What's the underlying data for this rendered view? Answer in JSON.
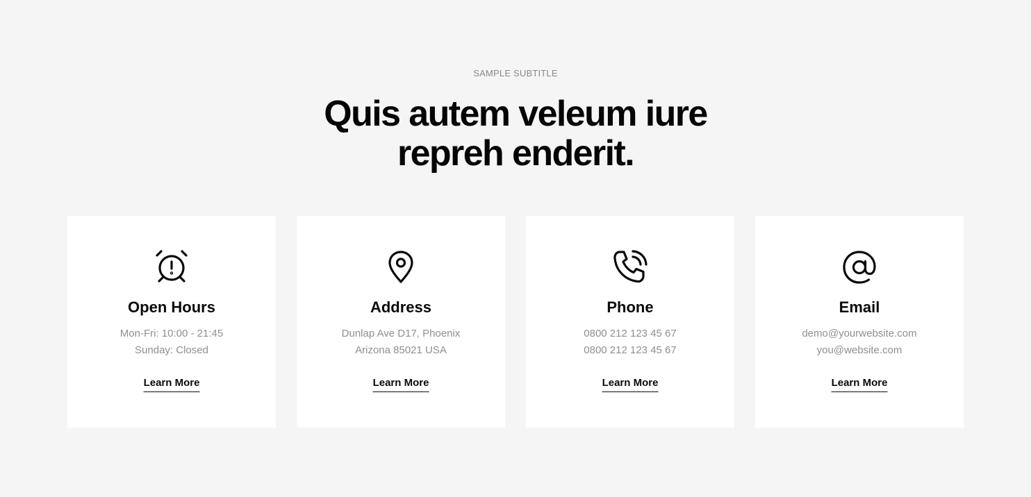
{
  "section": {
    "subtitle": "SAMPLE SUBTITLE",
    "heading": "Quis autem veleum iure repreh enderit."
  },
  "cards": [
    {
      "icon": "alarm-clock-icon",
      "title": "Open Hours",
      "line1": "Mon-Fri: 10:00 - 21:45",
      "line2": "Sunday: Closed",
      "link": "Learn More"
    },
    {
      "icon": "map-pin-icon",
      "title": "Address",
      "line1": "Dunlap Ave D17, Phoenix",
      "line2": "Arizona 85021 USA",
      "link": "Learn More"
    },
    {
      "icon": "phone-call-icon",
      "title": "Phone",
      "line1": "0800 212 123 45 67",
      "line2": "0800 212 123 45 67",
      "link": "Learn More"
    },
    {
      "icon": "at-sign-icon",
      "title": "Email",
      "line1": "demo@yourwebsite.com",
      "line2": "you@website.com",
      "link": "Learn More"
    }
  ],
  "colors": {
    "background": "#f5f5f5",
    "card": "#ffffff",
    "text": "#0a0a0a",
    "muted": "#8f8f8f"
  }
}
